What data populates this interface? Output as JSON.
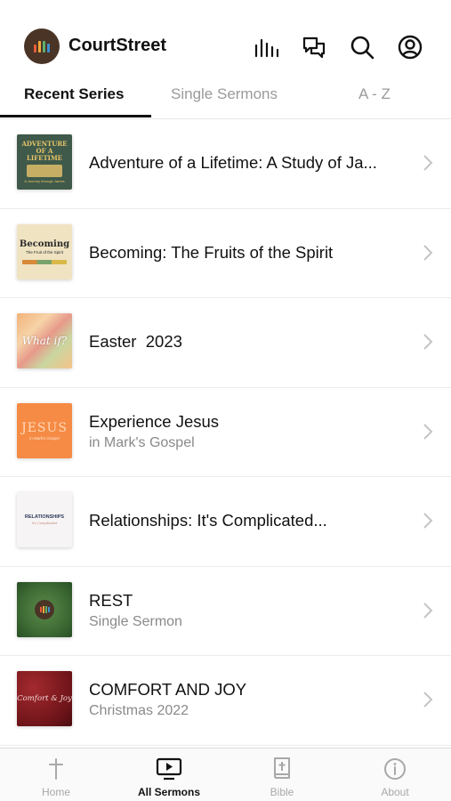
{
  "header": {
    "app_title": "CourtStreet",
    "logo_bar_colors": [
      "#e85d3a",
      "#f2a93b",
      "#5fae6e",
      "#3f8fcf"
    ],
    "icons": [
      "sermons-bars-icon",
      "chat-bubbles-icon",
      "search-icon",
      "account-icon"
    ]
  },
  "tabs": [
    {
      "label": "Recent Series",
      "active": true
    },
    {
      "label": "Single Sermons",
      "active": false
    },
    {
      "label": "A - Z",
      "active": false
    }
  ],
  "series": [
    {
      "title": "Adventure of a Lifetime: A Study of Ja...",
      "subtitle": "",
      "thumb_text": "ADVENTURE OF A LIFETIME",
      "thumb_subtext": "A Journey through James"
    },
    {
      "title": "Becoming: The Fruits of the Spirit",
      "subtitle": "",
      "thumb_text": "Becoming",
      "thumb_subtext": "The Fruit of the Spirit"
    },
    {
      "title": "Easter  2023",
      "subtitle": "",
      "thumb_text": "What if?"
    },
    {
      "title": "Experience Jesus",
      "subtitle": "in Mark's Gospel",
      "thumb_text": "JESUS",
      "thumb_subtext": "in Mark's Gospel"
    },
    {
      "title": "Relationships: It's Complicated...",
      "subtitle": "",
      "thumb_text": "RELATIONSHIPS",
      "thumb_subtext": "It's Complicated"
    },
    {
      "title": "REST",
      "subtitle": "Single Sermon",
      "thumb_text": ""
    },
    {
      "title": "COMFORT AND JOY",
      "subtitle": "Christmas 2022",
      "thumb_text": "Comfort & Joy"
    }
  ],
  "tab_bar": [
    {
      "label": "Home",
      "icon": "cross-icon",
      "active": false
    },
    {
      "label": "All Sermons",
      "icon": "video-play-icon",
      "active": true
    },
    {
      "label": "Bible",
      "icon": "bible-icon",
      "active": false
    },
    {
      "label": "About",
      "icon": "info-icon",
      "active": false
    }
  ]
}
